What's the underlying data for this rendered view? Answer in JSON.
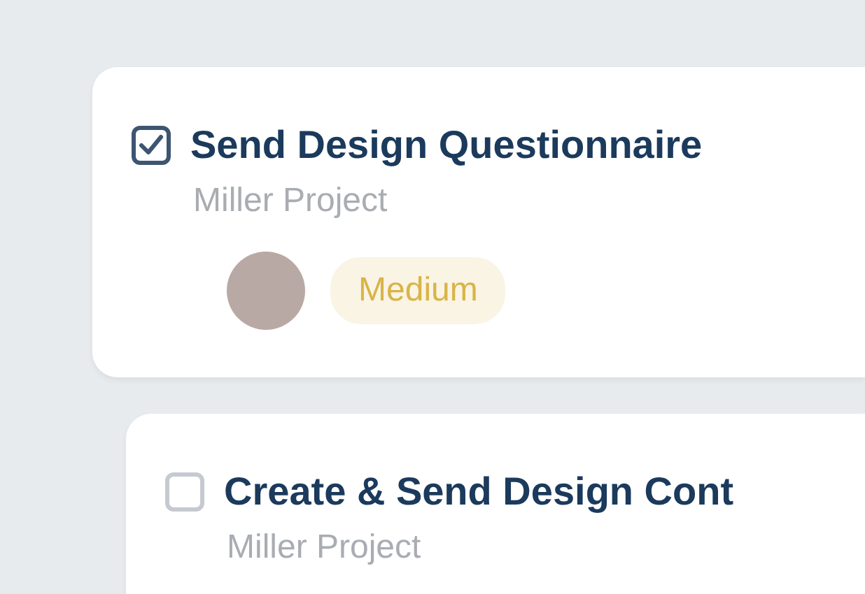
{
  "tasks": [
    {
      "title": "Send Design Questionnaire",
      "project": "Miller Project",
      "checked": true,
      "assignee": true,
      "priority": {
        "label": "Medium",
        "color": "#d9b447"
      }
    },
    {
      "title": "Create & Send Design Cont",
      "project": "Miller Project",
      "checked": false
    }
  ]
}
